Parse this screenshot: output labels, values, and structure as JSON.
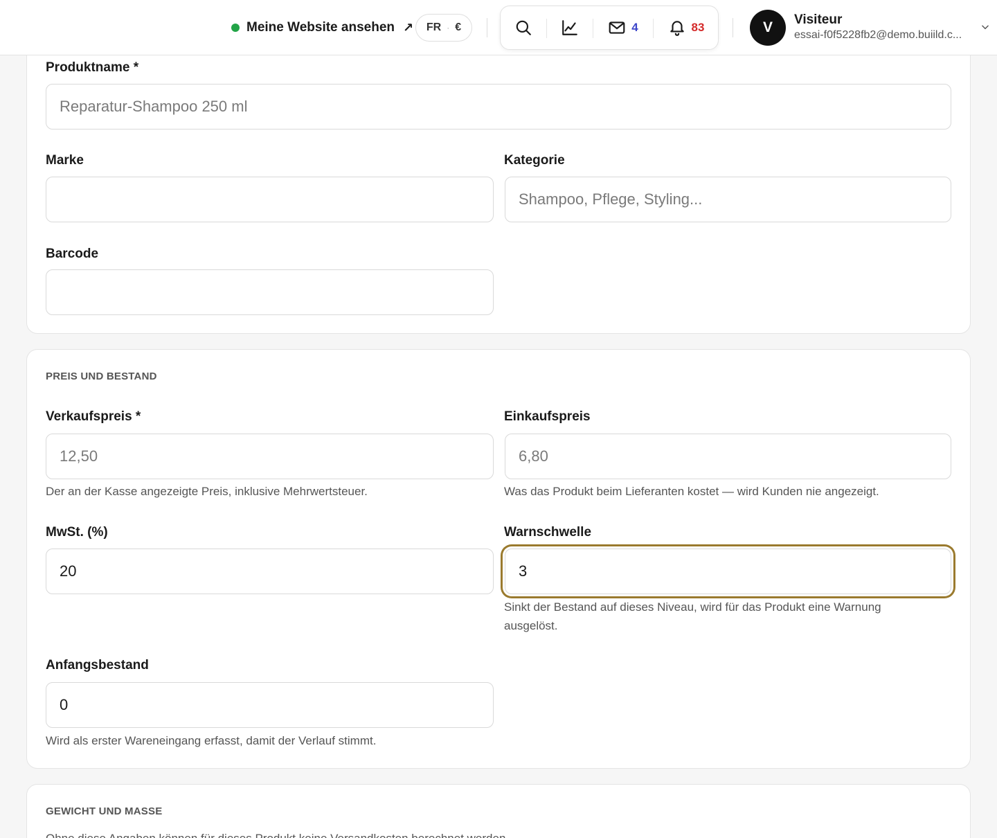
{
  "topbar": {
    "site_link_label": "Meine Website ansehen",
    "site_link_arrow": "↗",
    "site_status_color": "#22a447",
    "locale": {
      "language": "FR",
      "separator": "·",
      "currency": "€"
    },
    "tools": {
      "search_icon": "search-icon",
      "stats_icon": "chart-line-icon",
      "mail_icon": "mail-icon",
      "mail_count": "4",
      "bell_icon": "bell-icon",
      "notification_count": "83"
    },
    "user": {
      "avatar_initial": "V",
      "name": "Visiteur",
      "email": "essai-f0f5228fb2@demo.buiild.c..."
    }
  },
  "general": {
    "product_name": {
      "label": "Produktname *",
      "value": "",
      "placeholder": "Reparatur-Shampoo 250 ml"
    },
    "brand": {
      "label": "Marke",
      "value": "",
      "placeholder": ""
    },
    "category": {
      "label": "Kategorie",
      "value": "",
      "placeholder": "Shampoo, Pflege, Styling..."
    },
    "barcode": {
      "label": "Barcode",
      "value": "",
      "placeholder": ""
    }
  },
  "pricing": {
    "section_title": "PREIS UND BESTAND",
    "sale_price": {
      "label": "Verkaufspreis *",
      "value": "",
      "placeholder": "12,50",
      "hint": "Der an der Kasse angezeigte Preis, inklusive Mehrwertsteuer."
    },
    "purchase_price": {
      "label": "Einkaufspreis",
      "value": "",
      "placeholder": "6,80",
      "hint": "Was das Produkt beim Lieferanten kostet — wird Kunden nie angezeigt."
    },
    "vat": {
      "label": "MwSt. (%)",
      "value": "20",
      "placeholder": ""
    },
    "warning_threshold": {
      "label": "Warnschwelle",
      "value": "3",
      "placeholder": "",
      "hint": "Sinkt der Bestand auf dieses Niveau, wird für das Produkt eine Warnung ausgelöst."
    },
    "initial_stock": {
      "label": "Anfangsbestand",
      "value": "0",
      "placeholder": "",
      "hint": "Wird als erster Wareneingang erfasst, damit der Verlauf stimmt."
    }
  },
  "weight": {
    "section_title": "GEWICHT UND MASSE",
    "description": "Ohne diese Angaben können für dieses Produkt keine Versandkosten berechnet werden."
  },
  "colors": {
    "focus_ring": "#9a7a2e",
    "mail_badge": "#3d46c9",
    "notification_badge": "#d42a2a"
  }
}
